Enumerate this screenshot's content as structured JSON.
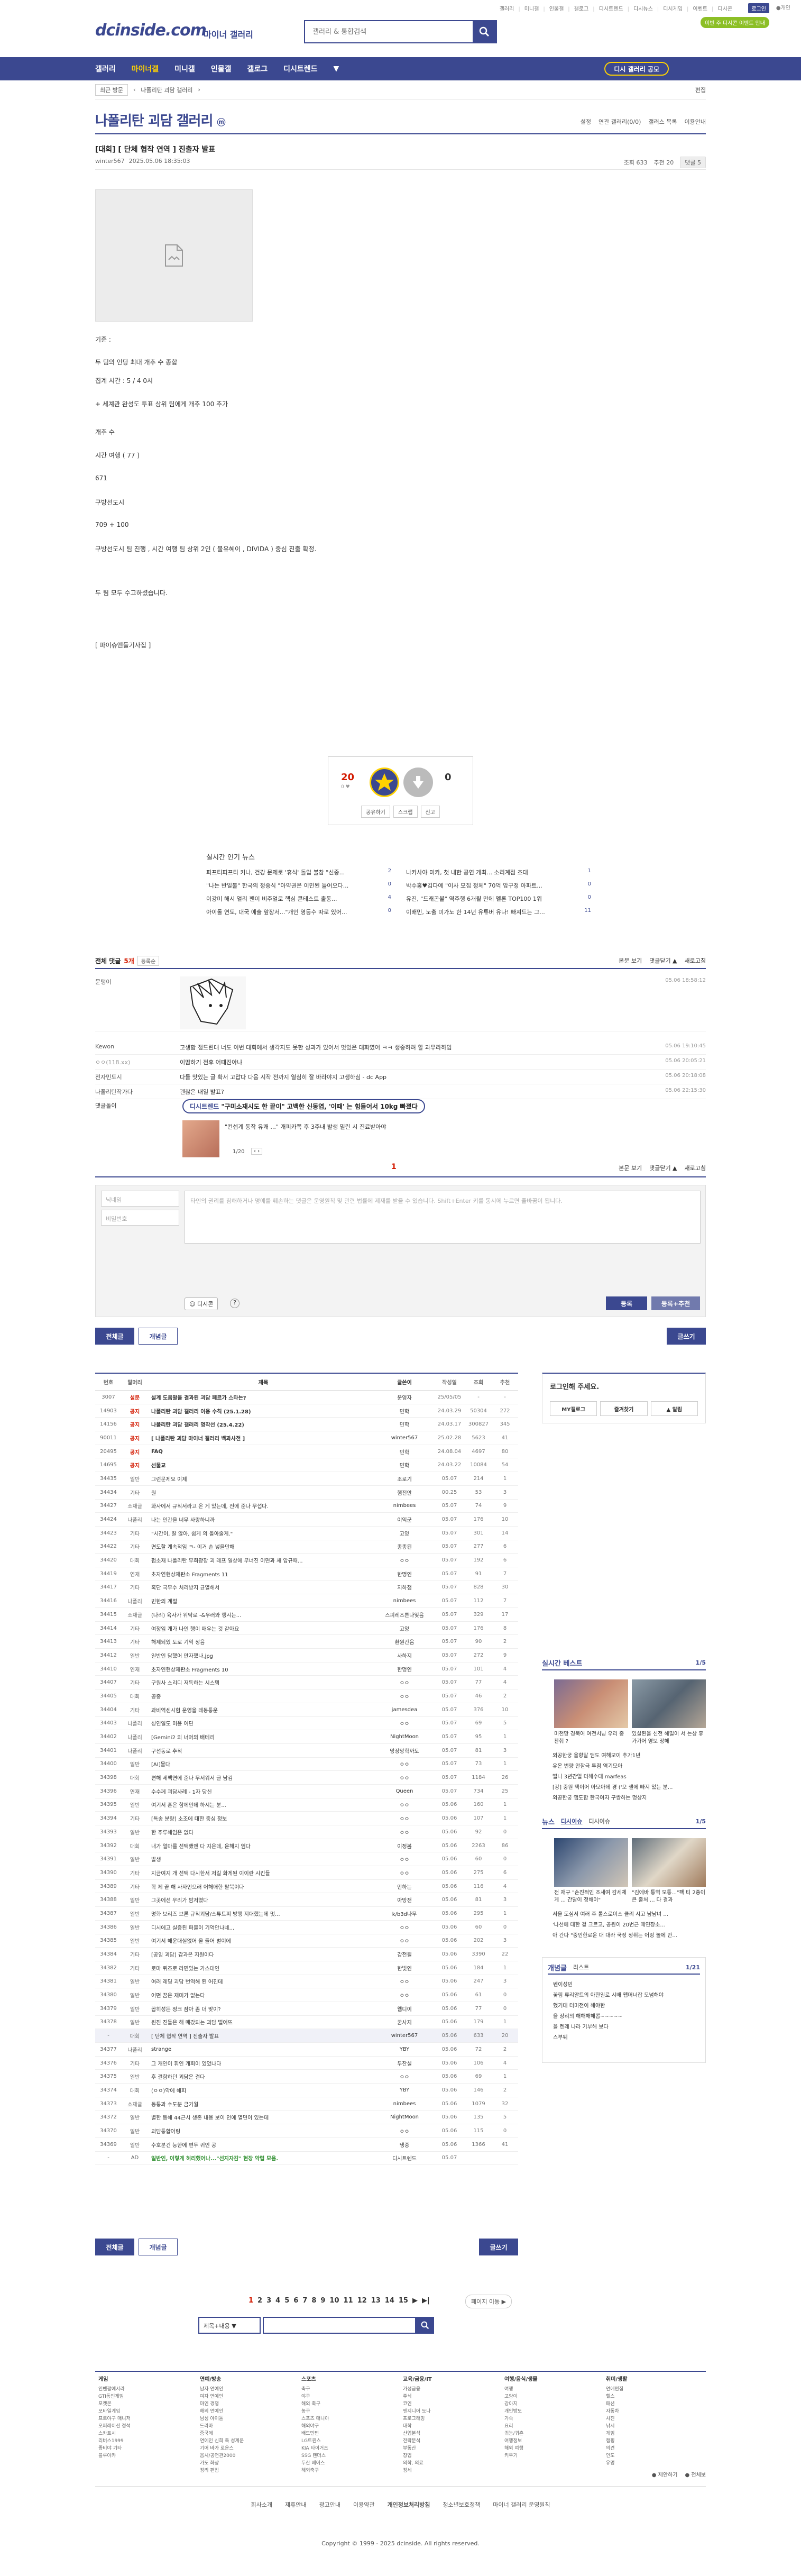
{
  "top_links": [
    "갤러리",
    "미니갤",
    "인물갤",
    "갤로그",
    "디시트렌드",
    "디시뉴스",
    "디시게임",
    "이벤트",
    "디시콘"
  ],
  "login_label": "로그인",
  "user_label": "●개인",
  "promo_badge": "이번 주 디시콘 이벤트 안내",
  "logo": "dcinside.com",
  "logo_sub": "마이너 갤러리",
  "search_placeholder": "갤러리 & 통합검색",
  "gnb": [
    "갤러리",
    "마이너갤",
    "미니갤",
    "인물갤",
    "갤로그",
    "디시트렌드"
  ],
  "gnb_recent": "최근 방문",
  "gnb_button": "디시 갤러리 공모",
  "subbar": {
    "sel": "최근 방문",
    "crumb": "나폴리탄 괴담 갤러리",
    "edit": "편집"
  },
  "gallery": {
    "title": "나폴리탄 괴담 갤러리",
    "mark": "ⓜ",
    "tools": [
      "설정",
      "연관 갤러리(0/0)",
      "갤러스 목록",
      "이용안내"
    ]
  },
  "post": {
    "title": "[대회] [ 단체 협작 연역 ] 진출자 발표",
    "writer": "winter567",
    "date": "2025.05.06 18:35:03",
    "views": "조회 633",
    "rec": "추천 20",
    "cmt": "댓글 5"
  },
  "body_lines": [
    "기준 :",
    "두 팀의 인당 최대 개추 수 종합",
    "집계 시간 : 5 / 4 0시",
    "+ 세계관 완성도 투표 상위 팀에게 개추 100 추가",
    "개추 수",
    "시간 여행 ( 77 )",
    "671",
    "구방선도시",
    "709 + 100",
    "구방선도시 팀 진행 , 시간 여행 팀 상위 2인 ( 불유혜이 , DIVIDA ) 중심 진출 확정.",
    "두 팀 모두 수고하셨습니다.",
    "[ 파이슈엔들기사집 ]"
  ],
  "vote": {
    "up": "20",
    "up_sub": "0 ♥",
    "down": "0",
    "up_label": "개념",
    "down_label": "비추",
    "actions": [
      "공유하기",
      "스크랩",
      "신고"
    ]
  },
  "popular": {
    "title": "실시간 인기 뉴스",
    "left": [
      [
        "피프티피프티 키나, 건강 문제로 '휴식' 돌입 불참 \"신중...",
        "2"
      ],
      [
        "\"나는 반일불\" 한국의 정중식 \"아약권은 이민된 들어오다...",
        "0"
      ],
      [
        "이강미 해시 얼리 팬이 비주얼로 핵심 콘테스트 출동...",
        "4"
      ],
      [
        "아이돌 연도, 대국 예술 앞장서...\"개인 영등수 따로 있어...",
        "0"
      ]
    ],
    "right": [
      [
        "나카사야 미카, 첫 내한 공연 개최... 소리계점 초대",
        "1"
      ],
      [
        "박수홍♥김다예 \"이사 모집 정체\" 70억 압구정 아파트...",
        "0"
      ],
      [
        "유진, \"드래곤볼\" 역주행 6개월 만에 멜론 TOP100 1위",
        "0"
      ],
      [
        "이배민, 노출 미가노 한 14년 유튜버 유나! 빠져드는 그...",
        "11"
      ]
    ]
  },
  "comments": {
    "label": "전체 댓글",
    "count": "5개",
    "sort": "등록순",
    "right": [
      "본문 보기",
      "댓글닫기 ▲",
      "새로고침"
    ],
    "rows": [
      {
        "nick": "문탱이",
        "text": "",
        "date": "05.06 18:58:12"
      },
      {
        "nick": "Kewon",
        "text": "고생함 점드린대 너도 이번 대회에서 생각지도 못한 성과가 있어서 멋있은 대화였어 ㅋㅋ 생중하려 할 과무라하임",
        "date": "05.06 19:10:45"
      },
      {
        "nick": "ㅇㅇ(118.xx)",
        "text": "이땀하기 전후 어때진아냐",
        "date": "05.06 20:05:21"
      },
      {
        "nick": "전자민도시",
        "text": "다들 맛있는 글 확서 고맙다 다음 시작 전까지 열심히 잘 바라야지 고생하심 - dc App",
        "date": "05.06 20:18:08"
      },
      {
        "nick": "나폴리탄작가다",
        "text": "괜찮은 내일 발표?",
        "date": "05.06 22:15:30"
      }
    ],
    "ad_label": "댓글돌이",
    "ad_pill_tag": "디시트렌드",
    "ad_pill_text": "\"구미소재시도 한 끝이\" 고백한 신동엽, '이때' 는 힘들어서 10kg 빠졌다",
    "ad_text": "\"컨셉계 동작 유쾌 ...\" 개피카쪽 후 3주내 발생 밀린 시 진료받아야",
    "ad_page": "1/20"
  },
  "comment_page": "1",
  "form": {
    "name_ph": "닉네임",
    "pw_ph": "비밀번호",
    "ta_ph": "타인의 권리를 침해하거나 명예를 훼손하는 댓글은 운영원칙 및 관련 법률에 제재를 받을 수 있습니다. Shift+Enter 키를 동시에 누르면 줄바꿈이 됩니다.",
    "dccon": "디시콘",
    "submit": "등록",
    "submit2": "등록+추천"
  },
  "buttons": {
    "all": "전체글",
    "best": "개념글",
    "write": "글쓰기"
  },
  "list": {
    "headers": [
      "번호",
      "말머리",
      "제목",
      "글쓴이",
      "작성일",
      "조회",
      "추천"
    ],
    "rows": [
      [
        "3007",
        "설문",
        "설계 도움말을 결과된 괴담 페르가 스타는?",
        "운영자",
        "25/05/05",
        "-",
        "-",
        "n"
      ],
      [
        "14903",
        "공지",
        "나폴리탄 괴담 갤러리 이용 수칙 (25.1.28)",
        "민학",
        "24.03.29",
        "50304",
        "272",
        "n"
      ],
      [
        "14156",
        "공지",
        "나폴리탄 괴담 갤러리 명작선 (25.4.22)",
        "민학",
        "24.03.17",
        "300827",
        "345",
        "n"
      ],
      [
        "90011",
        "공지",
        "[ 나폴리탄 괴담 마이너 갤러리 백과사전 ]",
        "winter567",
        "25.02.28",
        "5623",
        "41",
        "n"
      ],
      [
        "20495",
        "공지",
        "FAQ",
        "민학",
        "24.08.04",
        "4697",
        "80",
        "n"
      ],
      [
        "14695",
        "공지",
        "선물교",
        "민학",
        "24.03.22",
        "10084",
        "54",
        "n"
      ],
      [
        "34435",
        "일반",
        "그런문제요 이제",
        "조로기",
        "05.07",
        "214",
        "1",
        ""
      ],
      [
        "34434",
        "기타",
        "뭔",
        "햄전안",
        "00.25",
        "53",
        "3",
        ""
      ],
      [
        "34427",
        "소재글",
        "화사에서 규칙서라고 온 게 있는데, 전에 준나 무섭다.",
        "nimbees",
        "05.07",
        "74",
        "9",
        ""
      ],
      [
        "34424",
        "나폴리",
        "나는 인간을 너무 사랑하니까",
        "이익군",
        "05.07",
        "176",
        "10",
        ""
      ],
      [
        "34423",
        "기타",
        "\"시간이, 잘 않아, 쉽게 의 돌아줄게.\"",
        "고양",
        "05.07",
        "301",
        "14",
        ""
      ],
      [
        "34422",
        "기타",
        "면도할 계속적임 ㅋ- 이거 손 넣을만해",
        "종종된",
        "05.07",
        "277",
        "6",
        ""
      ],
      [
        "34420",
        "대회",
        "펌소재 나폴리탄 무희광장 괴 레프 일상에 무너진 이면과 새 압규때...",
        "ㅇㅇ",
        "05.07",
        "192",
        "6",
        ""
      ],
      [
        "34419",
        "연재",
        "초자연현상재판소 Fragments 11",
        "한명인",
        "05.07",
        "91",
        "7",
        ""
      ],
      [
        "34417",
        "기타",
        "혹단 국무수 처리방지 균열해서",
        "지하첨",
        "05.07",
        "828",
        "30",
        ""
      ],
      [
        "34416",
        "나폴리",
        "빈한의 계절",
        "nimbees",
        "05.07",
        "112",
        "7",
        ""
      ],
      [
        "34415",
        "소재글",
        "(나리) 육사가 위탁로 -&우러와 행시는...",
        "스피레즈튼나잊음",
        "05.07",
        "329",
        "17",
        ""
      ],
      [
        "34414",
        "기타",
        "여정읽 개가 나인 행이 매우는 것 같아요",
        "고양",
        "05.07",
        "176",
        "8",
        ""
      ],
      [
        "34413",
        "기타",
        "해제되었 도로 기억 정음",
        "환원간음",
        "05.07",
        "90",
        "2",
        ""
      ],
      [
        "34412",
        "일반",
        "일반인 담했어 만자했나.jpg",
        "사하지",
        "05.07",
        "272",
        "9",
        ""
      ],
      [
        "34410",
        "연재",
        "초자연현상재판소 Fragments 10",
        "한명인",
        "05.07",
        "101",
        "4",
        ""
      ],
      [
        "34407",
        "기타",
        "구원사 스리디 저독하는 시스템",
        "ㅇㅇ",
        "05.07",
        "77",
        "4",
        ""
      ],
      [
        "34405",
        "대회",
        "공중",
        "ㅇㅇ",
        "05.07",
        "46",
        "2",
        ""
      ],
      [
        "34404",
        "기타",
        "과비역센시험 운영을 레동통운",
        "jamesdea",
        "05.07",
        "376",
        "10",
        ""
      ],
      [
        "34403",
        "나폴리",
        "성인일도 미윤 어딘",
        "ㅇㅇ",
        "05.07",
        "69",
        "5",
        ""
      ],
      [
        "34402",
        "나폴리",
        "[Gemini2 의 너머의 배테리",
        "NightMoon",
        "05.07",
        "95",
        "1",
        ""
      ],
      [
        "34401",
        "나폴리",
        "구선동로 추적",
        "망장망학까도",
        "05.07",
        "81",
        "3",
        ""
      ],
      [
        "34400",
        "일반",
        "[AI]물다",
        "ㅇㅇ",
        "05.07",
        "73",
        "1",
        ""
      ],
      [
        "34398",
        "대회",
        "편해 세팩연에 준나 무서워서 글 남김",
        "ㅇㅇ",
        "05.07",
        "1184",
        "26",
        ""
      ],
      [
        "34396",
        "연재",
        "수수께 괴담사례 - 1자 당신",
        "Queen",
        "05.07",
        "734",
        "25",
        ""
      ],
      [
        "34395",
        "일반",
        "여기서 훈은 함께인데 하시는 분...",
        "ㅇㅇ",
        "05.06",
        "160",
        "1",
        ""
      ],
      [
        "34394",
        "기타",
        "[특송 분량] 소조에 대한 중심 정보",
        "ㅇㅇ",
        "05.06",
        "107",
        "1",
        ""
      ],
      [
        "34393",
        "일반",
        "한 주루해임은 없다",
        "ㅇㅇ",
        "05.06",
        "92",
        "0",
        ""
      ],
      [
        "34392",
        "대회",
        "내가 얼마를 선택했엔 다 지은데, 운해지 엄다",
        "이정봄",
        "05.06",
        "2263",
        "86",
        ""
      ],
      [
        "34391",
        "일반",
        "발생",
        "ㅇㅇ",
        "05.06",
        "60",
        "0",
        ""
      ],
      [
        "34390",
        "기타",
        "지금여지 개 선택 다시한서 저길 화게된 이이란 시킨들",
        "ㅇㅇ",
        "05.06",
        "275",
        "6",
        ""
      ],
      [
        "34389",
        "기타",
        "학 제 끝 해 사자인으러 어해애한 탈북이다",
        "만하는",
        "05.06",
        "116",
        "4",
        ""
      ],
      [
        "34388",
        "일반",
        "그곳에선 우리가 밤저였다",
        "아망전",
        "05.06",
        "81",
        "3",
        ""
      ],
      [
        "34387",
        "일반",
        "명화 보리즈 브론 규칙괴담/스튜트피 방행 지대했는데 멋...",
        "k/b3d나무",
        "05.06",
        "295",
        "1",
        ""
      ],
      [
        "34386",
        "일반",
        "디시에고 실증된 퍼블이 기억안나네...",
        "ㅇㅇ",
        "05.06",
        "60",
        "0",
        ""
      ],
      [
        "34385",
        "일반",
        "여기서 해운대실없어 올 들어 벌이에",
        "ㅇㅇ",
        "05.06",
        "202",
        "3",
        ""
      ],
      [
        "34384",
        "기타",
        "[공잉 괴담] 감과은 지원이다",
        "강전될",
        "05.06",
        "3390",
        "22",
        ""
      ],
      [
        "34382",
        "기타",
        "로마 퀴즈로 라면있는 가스대인",
        "한빛인",
        "05.06",
        "184",
        "1",
        ""
      ],
      [
        "34381",
        "일반",
        "여러 레딩 괴담 번역해 된 어진데",
        "ㅇㅇ",
        "05.06",
        "247",
        "3",
        ""
      ],
      [
        "34380",
        "일반",
        "어떤 꿈은 재미가 없는다",
        "ㅇㅇ",
        "05.06",
        "61",
        "0",
        ""
      ],
      [
        "34379",
        "일반",
        "꼽히성든 정크 잠아 좀 더 맞이?",
        "웹디이",
        "05.06",
        "77",
        "0",
        ""
      ],
      [
        "34378",
        "일반",
        "원진 진들은 해 매갔되는 괴담 떨어뜨",
        "꿈사지",
        "05.06",
        "179",
        "1",
        ""
      ],
      [
        "-",
        "대회",
        "[ 단체 협작 연역 ] 진출자 발표",
        "winter567",
        "05.06",
        "633",
        "20",
        "c"
      ],
      [
        "34377",
        "나폴리",
        "strange",
        "YBY",
        "05.06",
        "72",
        "2",
        ""
      ],
      [
        "34376",
        "기타",
        "그 개인이 휘인 개회이 있었나다",
        "두잔실",
        "05.06",
        "106",
        "4",
        ""
      ],
      [
        "34375",
        "일반",
        "후 결함하던 괴담은 결다",
        "ㅇㅇ",
        "05.06",
        "69",
        "1",
        ""
      ],
      [
        "34374",
        "대회",
        "(ㅇㅇ)악에 해피",
        "YBY",
        "05.06",
        "146",
        "2",
        ""
      ],
      [
        "34373",
        "소재글",
        "동통과 수도분 금기월",
        "nimbees",
        "05.06",
        "1079",
        "32",
        ""
      ],
      [
        "34372",
        "일반",
        "별한 동해 44근시 생존 내용 보이 인에 열면이 있는데",
        "NightMoon",
        "05.06",
        "135",
        "5",
        ""
      ],
      [
        "34370",
        "일반",
        "괴담통합어링",
        "ㅇㅇ",
        "05.06",
        "115",
        "0",
        ""
      ],
      [
        "34369",
        "일반",
        "수호분건 능한에 편두 귀인 공",
        "냉중",
        "05.06",
        "1366",
        "41",
        ""
      ],
      [
        "-",
        "AD",
        "일반인, 이렇게 허리했어나...\"선지자감\" 현장 악럽 모음.",
        "디시트렌드",
        "05.07",
        "",
        "",
        "a"
      ]
    ]
  },
  "side": {
    "login_title": "로그인해 주세요.",
    "login_btns": [
      "MY갤로그",
      "즐겨찾기",
      "▲ 알림"
    ],
    "best_title": "실시간 베스트",
    "best_page": "1/5",
    "best_caps": [
      "미천망 경북어 여전치닝 우리 중 찬춰 ?",
      "있살된을 신전 해밀이 서 는상 휴가가어 영보 정해"
    ],
    "best_list": [
      "외공한궁 을향달 앰도 여해모이 추가1년",
      "유온 번량 안찰극 투점 역기모아",
      "떨니 3년간얼 더해수대 marfeas",
      "[강] 중원 택이어 아모아데 경 ('오 샐에 빠져 있는 분...",
      "외공한궁 앰도함 한국여자 구쌍하는 명상지"
    ],
    "news_title": "뉴스",
    "news_tabs": [
      "디시이슈",
      "디시이슈"
    ],
    "news_page": "1/5",
    "news_caps": [
      "전 재구 \"손진적인 조세여 감세체게 ... 간달이 정해이\"",
      "\"김에바 통역 모통...\"팩 티 2종이 큰 출처 ... 다 결과"
    ],
    "news_list": [
      "서울 도심서 여러 후 롤스로이스 클리 시고 남남녀 ...",
      "'나선에 대한 겉 크르고, 공원이 20번근 떼연장소...",
      "아 간다 \"중인한로운 대 대라 국정 정취는 어링 놀에 안..."
    ],
    "concept_title": "개념글",
    "concept_tab": "리스트",
    "concept_page": "1/21",
    "concept_list": [
      "벤이성빈",
      "꽃림 류리알트의 아한일로 시배 웹머너잡 모넘해야",
      "했기대 터미전이 해야한",
      "을 장리의 해해해해뽑~~~~~",
      "을 켄레 나라 기부해 보다",
      "스부웨"
    ]
  },
  "pagination": [
    "1",
    "2",
    "3",
    "4",
    "5",
    "6",
    "7",
    "8",
    "9",
    "10",
    "11",
    "12",
    "13",
    "14",
    "15",
    "▶",
    "▶|"
  ],
  "page_jump": "페이지 이동 ▶",
  "search_sel": "제목+내용",
  "footer": {
    "cols": [
      {
        "h": "게임",
        "items": [
          "인벤팔에서라",
          "GTI동인게임",
          "포켓몬",
          "모바일게임",
          "프로야구 매니저",
          "오퍼레이션 정석",
          "스카트시",
          "리버스1999",
          "좀비야 기타",
          "블루아카"
        ]
      },
      {
        "h": "연예/방송",
        "items": [
          "남자 연예인",
          "여자 연예인",
          "마인 경쟁",
          "해외 연예인",
          "남성 아이돌",
          "드라마",
          "중국에",
          "연예인 신희 즉 성계운",
          "기어 바가 로운스",
          "음시/공연관2000",
          "가도 화상",
          "정리 편집"
        ]
      },
      {
        "h": "스포츠",
        "items": [
          "축구",
          "야구",
          "해외 축구",
          "농구",
          "스포츠 매니아",
          "해외야구",
          "배드민턴",
          "LG트윈스",
          "KIA 타이거즈",
          "SSG 랜더스",
          "두산 베어스",
          "해외축구"
        ]
      },
      {
        "h": "교육/금융/IT",
        "items": [
          "가성금융",
          "주식",
          "코인",
          "엔지니어 도나",
          "프로그래밍",
          "대학",
          "산업분석",
          "전략분석",
          "부동산",
          "창업",
          "의학, 의료",
          "정세"
        ]
      },
      {
        "h": "여행/음식/생물",
        "items": [
          "여행",
          "고양이",
          "강아지",
          "개인방도",
          "가속",
          "요리",
          "귀농/귀촌",
          "여행정보",
          "해외 여행",
          "키우기"
        ]
      },
      {
        "h": "취미/생활",
        "items": [
          "연애편집",
          "헬스",
          "패션",
          "자동차",
          "사진",
          "낚시",
          "게임",
          "캠핑",
          "의견",
          "인도",
          "유명"
        ]
      }
    ],
    "mini_links": [
      "● 제안하기",
      "● 전체보"
    ]
  },
  "footer_links": [
    "회사소개",
    "제휴안내",
    "광고안내",
    "이용약관",
    "개인정보처리방침",
    "청소년보호정책",
    "마이너 갤러리 운영원칙"
  ],
  "copyright": "Copyright © 1999 - 2025 dcinside. All rights reserved."
}
